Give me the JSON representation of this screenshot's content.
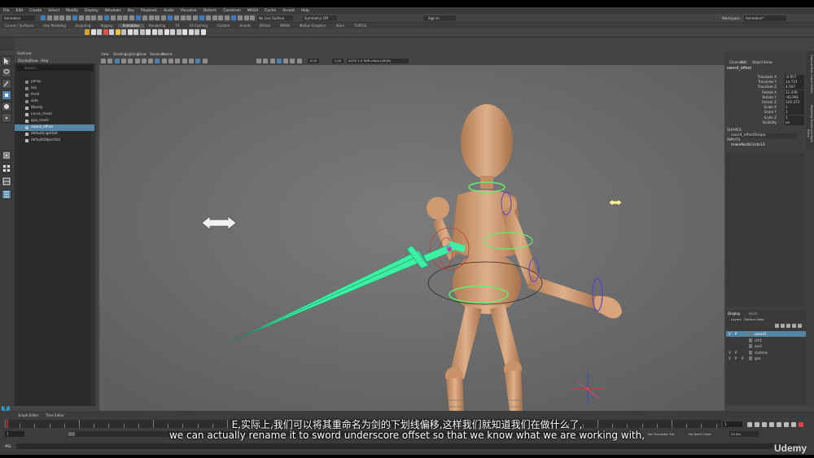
{
  "menu": [
    "File",
    "Edit",
    "Create",
    "Select",
    "Modify",
    "Display",
    "Windows",
    "Key",
    "Playback",
    "Audio",
    "Visualize",
    "Deform",
    "Constrain",
    "MASH",
    "Cache",
    "Arnold",
    "Help"
  ],
  "workspace_label": "Workspace :",
  "workspace_value": "Animation*",
  "mode_value": "Animation",
  "live_surface": "No Live Surface",
  "symmetry": "Symmetry: Off",
  "login": "Sign In",
  "shelf_tabs": [
    "Curves / Surfaces",
    "Poly Modeling",
    "Sculpting",
    "Rigging",
    "Animation",
    "Rendering",
    "FX",
    "FX Caching",
    "Custom",
    "Arnold",
    "Bifrost",
    "MASH",
    "Motion Graphics",
    "XGen",
    "TURTLE"
  ],
  "active_shelf": "Animation",
  "outliner": {
    "title": "Outliner",
    "menu": [
      "Display",
      "Show",
      "Help"
    ],
    "search_placeholder": "Search...",
    "items": [
      "persp",
      "top",
      "front",
      "side",
      "Woody",
      "curve_mesh",
      "quo_mesh",
      "sword_offset",
      "defaultLightSet",
      "defaultObjectSet"
    ],
    "selected": "sword_offset"
  },
  "viewport": {
    "menu": [
      "View",
      "Shading",
      "Lighting",
      "Show",
      "Renderer",
      "Panels"
    ],
    "field1": "0.00",
    "field2": "1.00",
    "colorspace": "ACES 1.0 SDR-video (sRGB)"
  },
  "channel_box": {
    "menu": [
      "Channels",
      "Edit",
      "Object",
      "Show"
    ],
    "object": "sword_offset",
    "channels": [
      {
        "name": "Translate X",
        "value": "-0.957"
      },
      {
        "name": "Translate Y",
        "value": "14.721"
      },
      {
        "name": "Translate Z",
        "value": "4.597"
      },
      {
        "name": "Rotate X",
        "value": "11.439"
      },
      {
        "name": "Rotate Y",
        "value": "-45.991"
      },
      {
        "name": "Rotate Z",
        "value": "120.373"
      },
      {
        "name": "Scale X",
        "value": "1"
      },
      {
        "name": "Scale Y",
        "value": "1"
      },
      {
        "name": "Scale Z",
        "value": "1"
      },
      {
        "name": "Visibility",
        "value": "on"
      }
    ],
    "shapes_label": "SHAPES",
    "shape": "sword_offsetShape",
    "inputs_label": "INPUTS",
    "input": "makeNurbCircle13"
  },
  "layer_editor": {
    "tabs": [
      "Display",
      "Anim"
    ],
    "menu": [
      "Layers",
      "Options",
      "Help"
    ],
    "layers": [
      {
        "v": "V",
        "p": "P",
        "name": "sword1"
      },
      {
        "v": "",
        "p": "",
        "name": "ctrl1"
      },
      {
        "v": "",
        "p": "",
        "name": "ass1"
      },
      {
        "v": "V",
        "p": "P",
        "name": "controls"
      },
      {
        "v": "V",
        "p": "P",
        "r": "R",
        "name": "geo"
      }
    ]
  },
  "side_tabs": [
    "Channel Box / Layer Editor",
    "Modeling Toolkit",
    "Attribute Editor"
  ],
  "bottom": {
    "editor_tabs": [
      "Graph Editor",
      "Time Editor"
    ],
    "frame_start": "1",
    "frame_current": "1",
    "fps": "24 fps",
    "character_set": "No Character Set",
    "anim_layer": "No Anim Layer",
    "command_label": "MEL"
  },
  "subtitles": {
    "line1": "E,实际上,我们可以将其重命名为剑的下划线偏移,这样我们就知道我们在做什么了,",
    "line2": "we can actually rename it to sword underscore offset so that we know what we are working with,"
  },
  "brand": "Udemy",
  "colors": {
    "selection": "#5285a6",
    "sword": "#3df0a4",
    "mannequin": "#d9a47a",
    "control": "#63f06a"
  }
}
